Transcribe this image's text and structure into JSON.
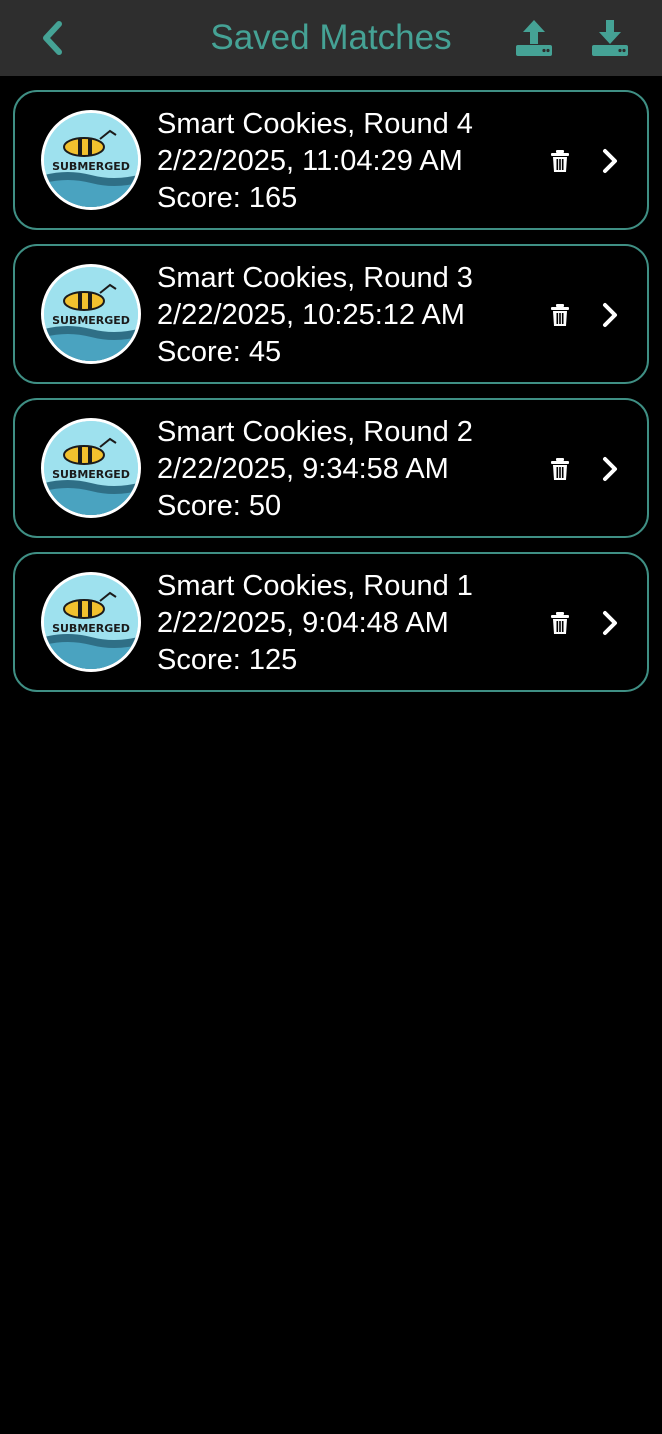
{
  "header": {
    "title": "Saved Matches",
    "back_icon": "chevron-left-icon",
    "upload_icon": "upload-icon",
    "download_icon": "download-icon",
    "accent_color": "#45a295",
    "background_color": "#2e2e2e"
  },
  "matches": [
    {
      "title": "Smart Cookies, Round 4",
      "datetime": "2/22/2025, 11:04:29 AM",
      "score": "Score: 165",
      "logo_text": "SUBMERGED"
    },
    {
      "title": "Smart Cookies, Round 3",
      "datetime": "2/22/2025, 10:25:12 AM",
      "score": "Score: 45",
      "logo_text": "SUBMERGED"
    },
    {
      "title": "Smart Cookies, Round 2",
      "datetime": "2/22/2025, 9:34:58 AM",
      "score": "Score: 50",
      "logo_text": "SUBMERGED"
    },
    {
      "title": "Smart Cookies, Round 1",
      "datetime": "2/22/2025, 9:04:48 AM",
      "score": "Score: 125",
      "logo_text": "SUBMERGED"
    }
  ],
  "card_icons": {
    "delete": "trash-icon",
    "open": "chevron-right-icon"
  },
  "colors": {
    "card_border": "#3f8f84",
    "page_background": "#000000",
    "text": "#ffffff"
  }
}
